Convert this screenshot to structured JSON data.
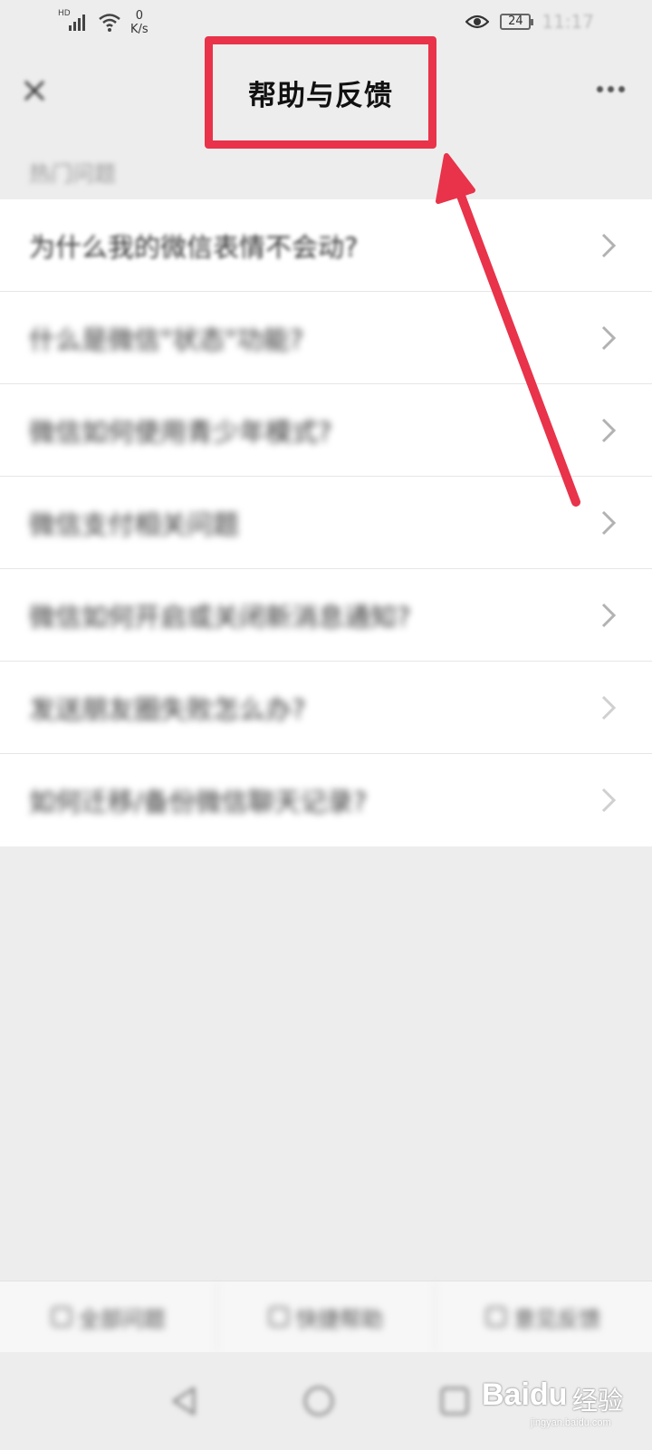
{
  "status_bar": {
    "signal_label": "HD",
    "net_speed_value": "0",
    "net_speed_unit": "K/s",
    "battery": "24",
    "time": "11:17"
  },
  "header": {
    "title": "帮助与反馈"
  },
  "section": {
    "label": "热门问题"
  },
  "faq": [
    "为什么我的微信表情不会动?",
    "什么是微信\"状态\"功能?",
    "微信如何使用青少年模式?",
    "微信支付相关问题",
    "微信如何开启或关闭新消息通知?",
    "发送朋友圈失败怎么办?",
    "如何迁移/备份微信聊天记录?"
  ],
  "bottom_bar": {
    "items": [
      "全部问题",
      "快捷帮助",
      "意见反馈"
    ]
  },
  "watermark": {
    "logo": "Baidu",
    "text": "经验",
    "sub": "jingyan.baidu.com"
  },
  "colors": {
    "annotation_red": "#e8334a",
    "background": "#ededed"
  }
}
